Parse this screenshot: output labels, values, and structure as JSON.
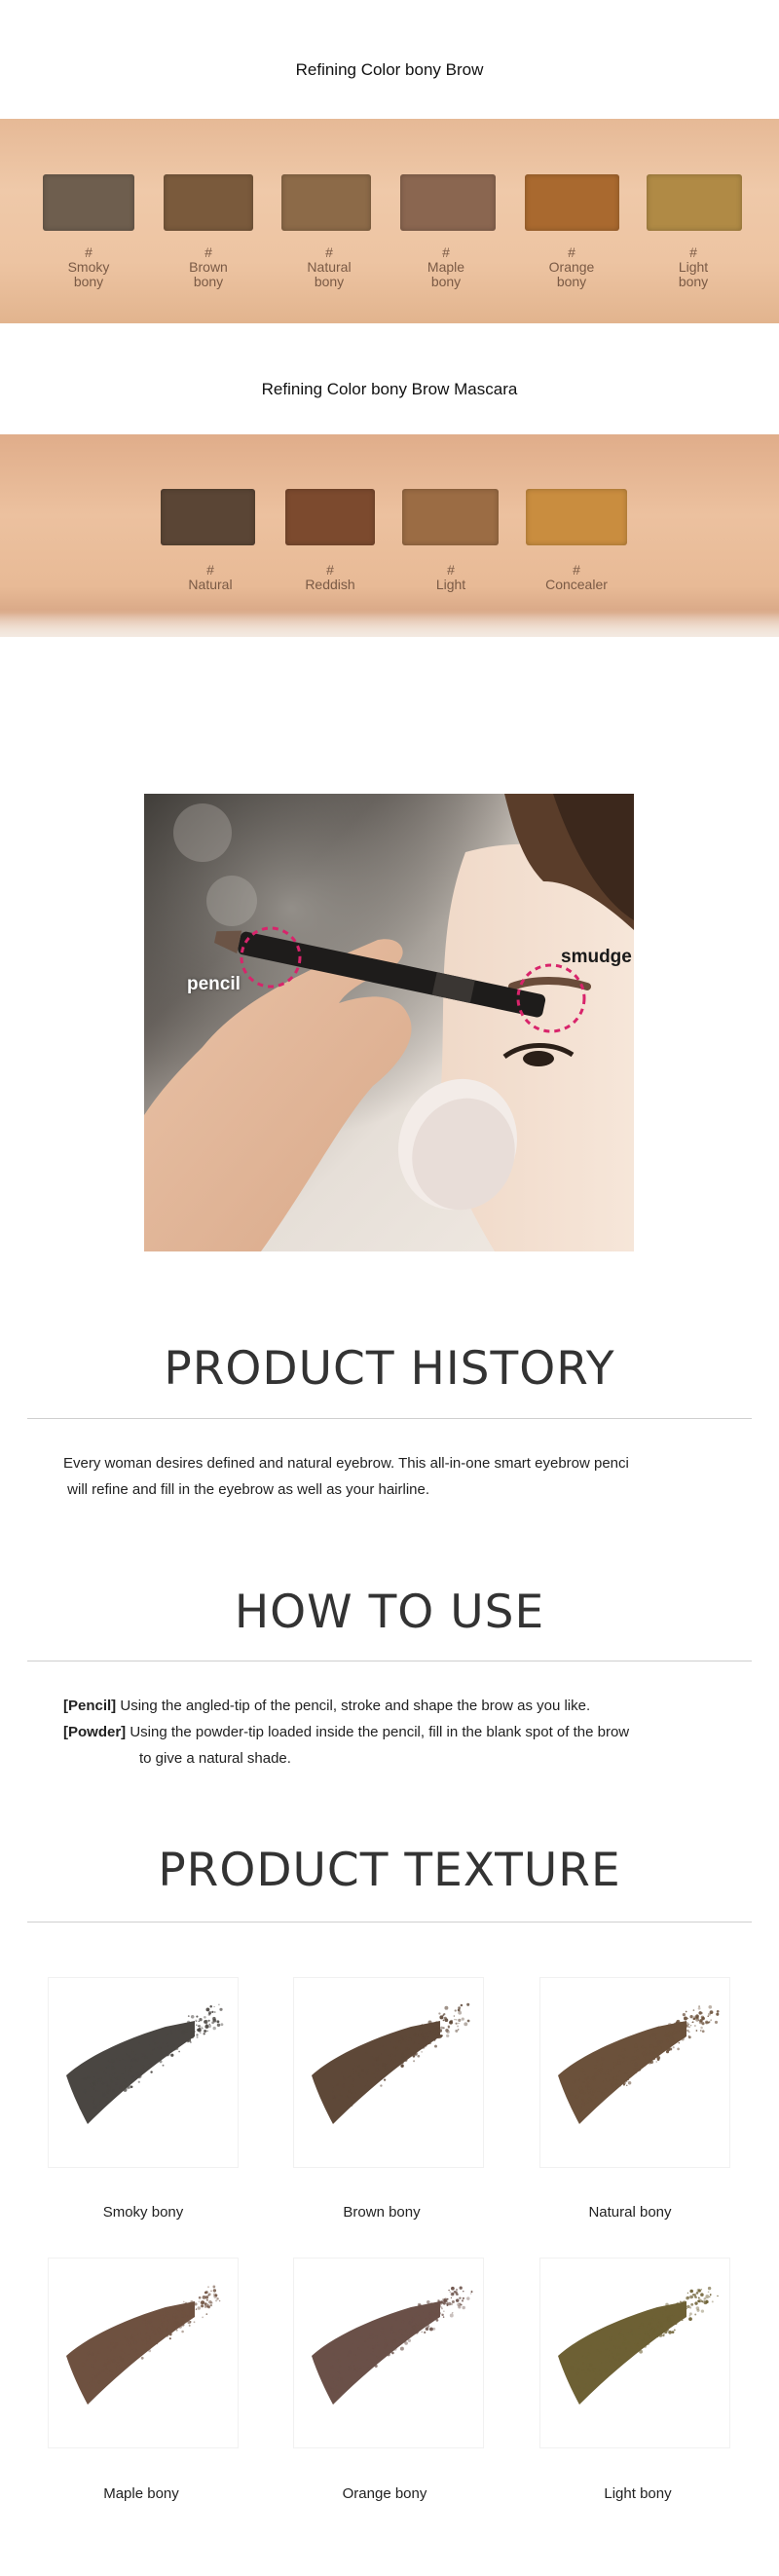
{
  "brow": {
    "title": "Refining Color bony Brow",
    "swatches": [
      {
        "hash": "#",
        "name": "Smoky\nbony",
        "color": "#6e5e4e"
      },
      {
        "hash": "#",
        "name": "Brown\nbony",
        "color": "#7a5a3c"
      },
      {
        "hash": "#",
        "name": "Natural\nbony",
        "color": "#8c6a48"
      },
      {
        "hash": "#",
        "name": "Maple\nbony",
        "color": "#8a6650"
      },
      {
        "hash": "#",
        "name": "Orange\nbony",
        "color": "#a9692f"
      },
      {
        "hash": "#",
        "name": "Light\nbony",
        "color": "#b08a45"
      }
    ]
  },
  "mascara": {
    "title": "Refining Color bony Brow Mascara",
    "swatches": [
      {
        "hash": "#",
        "name": "Natural",
        "color": "#5a4535"
      },
      {
        "hash": "#",
        "name": "Reddish",
        "color": "#7c4a2e"
      },
      {
        "hash": "#",
        "name": "Light",
        "color": "#9b6c44"
      },
      {
        "hash": "#",
        "name": "Concealer",
        "color": "#c98d3f"
      }
    ]
  },
  "photo": {
    "pencil_label": "pencil",
    "smudge_label": "smudge"
  },
  "history": {
    "heading": "PRODUCT HISTORY",
    "line1": "Every woman desires defined and natural eyebrow. This all-in-one smart eyebrow penci",
    "line2": " will refine and fill in the eyebrow as well as your hairline."
  },
  "howto": {
    "heading": "HOW TO USE",
    "pencil_tag": "[Pencil]",
    "pencil_text": " Using the angled-tip of the pencil, stroke and shape the brow as you like.",
    "powder_tag": "[Powder]",
    "powder_text": " Using the powder-tip loaded inside the pencil, fill in the blank spot of the brow",
    "powder_text2": "to give a natural shade."
  },
  "texture": {
    "heading": "PRODUCT TEXTURE",
    "items": [
      {
        "label": "Smoky bony",
        "color": "#4a4642"
      },
      {
        "label": "Brown bony",
        "color": "#5e4838"
      },
      {
        "label": "Natural bony",
        "color": "#6b513b"
      },
      {
        "label": "Maple bony",
        "color": "#6e5140"
      },
      {
        "label": "Orange bony",
        "color": "#6a5048"
      },
      {
        "label": "Light bony",
        "color": "#6d6034"
      }
    ]
  }
}
